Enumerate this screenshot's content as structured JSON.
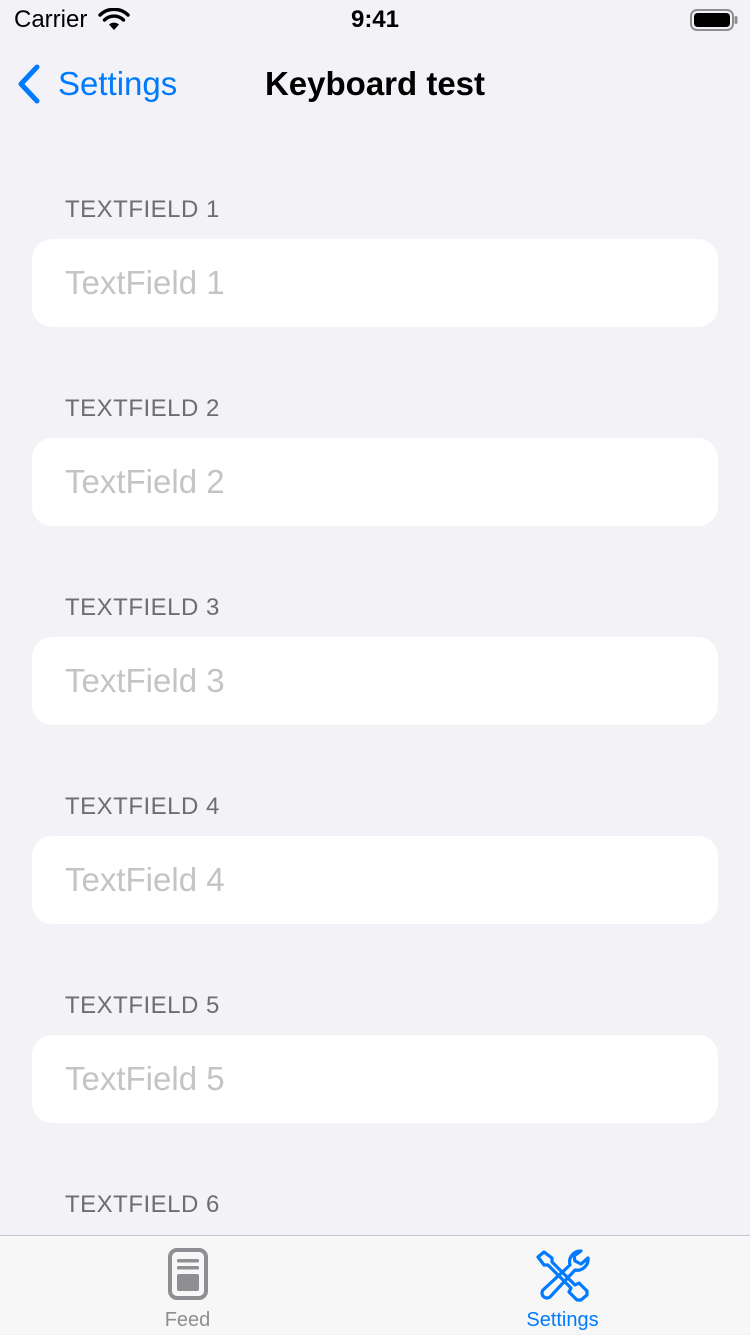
{
  "status_bar": {
    "carrier": "Carrier",
    "time": "9:41"
  },
  "nav": {
    "back_label": "Settings",
    "title": "Keyboard test"
  },
  "form": {
    "sections": [
      {
        "header": "TEXTFIELD 1",
        "placeholder": "TextField 1",
        "value": ""
      },
      {
        "header": "TEXTFIELD 2",
        "placeholder": "TextField 2",
        "value": ""
      },
      {
        "header": "TEXTFIELD 3",
        "placeholder": "TextField 3",
        "value": ""
      },
      {
        "header": "TEXTFIELD 4",
        "placeholder": "TextField 4",
        "value": ""
      },
      {
        "header": "TEXTFIELD 5",
        "placeholder": "TextField 5",
        "value": ""
      },
      {
        "header": "TEXTFIELD 6"
      }
    ]
  },
  "tab_bar": {
    "tabs": [
      {
        "label": "Feed",
        "icon": "feed-icon",
        "selected": false
      },
      {
        "label": "Settings",
        "icon": "settings-tools-icon",
        "selected": true
      }
    ]
  },
  "colors": {
    "accent": "#007aff",
    "background": "#f2f2f7",
    "inactive_tab": "#8e8e93",
    "section_header": "#6d6d72",
    "placeholder": "#c4c4c7"
  }
}
